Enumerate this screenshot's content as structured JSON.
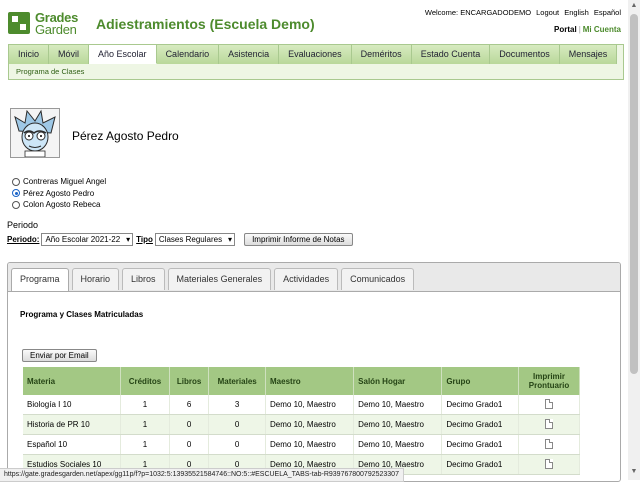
{
  "logo": {
    "line1": "Grades",
    "line2": "Garden"
  },
  "school_title": "Adiestramientos (Escuela Demo)",
  "top_links": {
    "welcome": "Welcome: ENCARGADODEMO",
    "logout": "Logout",
    "english": "English",
    "espanol": "Español"
  },
  "portal_links": {
    "portal": "Portal",
    "sep": "|",
    "mi_cuenta": "Mi Cuenta"
  },
  "nav": {
    "tabs": [
      "Inicio",
      "Móvil",
      "Año Escolar",
      "Calendario",
      "Asistencia",
      "Evaluaciones",
      "Deméritos",
      "Estado Cuenta",
      "Documentos",
      "Mensajes"
    ],
    "active": "Año Escolar",
    "sub": "Programa de Clases"
  },
  "student": {
    "name": "Pérez Agosto Pedro"
  },
  "students": [
    {
      "name": "Contreras Miguel Angel",
      "selected": false
    },
    {
      "name": "Pérez Agosto Pedro",
      "selected": true
    },
    {
      "name": "Colon Agosto Rebeca",
      "selected": false
    }
  ],
  "periodo": {
    "label": "Periodo",
    "periodo_label": "Periodo:",
    "periodo_value": "Año Escolar 2021-22",
    "tipo_label": "Tipo",
    "tipo_value": "Clases Regulares",
    "print_button": "Imprimir Informe de Notas"
  },
  "tabs": [
    "Programa",
    "Horario",
    "Libros",
    "Materiales Generales",
    "Actividades",
    "Comunicados"
  ],
  "active_tab": "Programa",
  "section_title": "Programa y Clases Matriculadas",
  "email_button": "Enviar por Email",
  "table": {
    "headers": [
      "Materia",
      "Créditos",
      "Libros",
      "Materiales",
      "Maestro",
      "Salón Hogar",
      "Grupo",
      "Imprimir Prontuario"
    ],
    "rows": [
      [
        "Biología I 10",
        "1",
        "6",
        "3",
        "Demo 10, Maestro",
        "Demo 10, Maestro",
        "Decimo Grado1"
      ],
      [
        "Historia de PR 10",
        "1",
        "0",
        "0",
        "Demo 10, Maestro",
        "Demo 10, Maestro",
        "Decimo Grado1"
      ],
      [
        "Español 10",
        "1",
        "0",
        "0",
        "Demo 10, Maestro",
        "Demo 10, Maestro",
        "Decimo Grado1"
      ],
      [
        "Estudios Sociales 10",
        "1",
        "0",
        "0",
        "Demo 10, Maestro",
        "Demo 10, Maestro",
        "Decimo Grado1"
      ]
    ]
  },
  "status_url": "https://gate.gradesgarden.net/apex/gg11p/f?p=1032:5:13935521584746::NO:5::#ESCUELA_TABS-tab-R939767800792523307",
  "colors": {
    "brand": "#4d8b2d",
    "nav_bg": "#d7ebc0",
    "table_header": "#a3c884"
  }
}
